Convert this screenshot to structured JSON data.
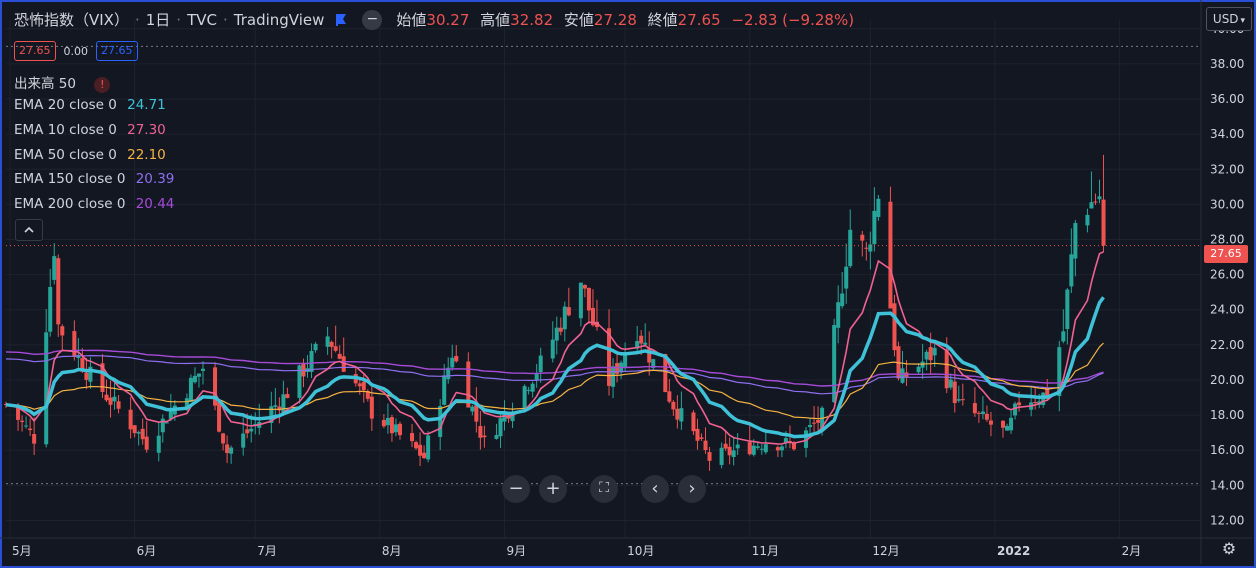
{
  "header": {
    "symbol_title": "恐怖指数（VIX）",
    "interval": "1日",
    "exchange": "TVC",
    "source": "TradingView",
    "flag_icon": "flag-icon",
    "hide_icon": "minus-circle-icon",
    "ohlc": [
      {
        "label": "始値",
        "value": "30.27"
      },
      {
        "label": "高値",
        "value": "32.82"
      },
      {
        "label": "安値",
        "value": "27.28"
      },
      {
        "label": "終値",
        "value": "27.65"
      }
    ],
    "change": "−2.83 (−9.28%)",
    "price_badges": {
      "bid": "27.65",
      "spread": "0.00",
      "ask": "27.65"
    },
    "currency": "USD"
  },
  "indicators": [
    {
      "label": "出来高 50",
      "value": "",
      "color": "#d1d4dc",
      "warning_icon": "exclamation-icon"
    },
    {
      "label": "EMA 20 close 0",
      "value": "24.71",
      "color": "#3fc1d8"
    },
    {
      "label": "EMA 10 close 0",
      "value": "27.30",
      "color": "#f06292"
    },
    {
      "label": "EMA 50 close 0",
      "value": "22.10",
      "color": "#f5b342"
    },
    {
      "label": "EMA 150 close 0",
      "value": "20.39",
      "color": "#8e6ff0"
    },
    {
      "label": "EMA 200 close 0",
      "value": "20.44",
      "color": "#a64bd8"
    }
  ],
  "collapse_icon": "chevron-up-icon",
  "last_price_label": "27.65",
  "navigation": {
    "zoom_out_icon": "minus-icon",
    "zoom_in_icon": "plus-icon",
    "reset_icon": "reset-view-icon",
    "scroll_left_icon": "chevron-left-icon",
    "scroll_right_icon": "chevron-right-icon",
    "settings_icon": "gear-icon"
  },
  "chart_data": {
    "type": "candlestick",
    "ylim": [
      11,
      40.5
    ],
    "y_ticks": [
      "40.00",
      "38.00",
      "36.00",
      "34.00",
      "32.00",
      "30.00",
      "28.00",
      "26.00",
      "24.00",
      "22.00",
      "20.00",
      "18.00",
      "16.00",
      "14.00",
      "12.00"
    ],
    "x_ticks": [
      "5月",
      "6月",
      "7月",
      "8月",
      "9月",
      "10月",
      "11月",
      "12月",
      "2022",
      "2月"
    ],
    "x_tick_dates": [
      "2021-05-01",
      "2021-06-01",
      "2021-07-01",
      "2021-08-01",
      "2021-09-01",
      "2021-10-01",
      "2021-11-01",
      "2021-12-01",
      "2022-01-01",
      "2022-02-01"
    ],
    "x_range": [
      "2021-04-30",
      "2022-02-21"
    ],
    "dotted_high_level": 39.0,
    "dotted_low_level": 14.1,
    "series_colors": {
      "up": "#26a69a",
      "down": "#ef5350"
    },
    "ohlc_anchor": [
      {
        "date": "2021-04-30",
        "close": 18.6
      },
      {
        "date": "2021-05-07",
        "close": 16.7
      },
      {
        "date": "2021-05-12",
        "close": 27.6
      },
      {
        "date": "2021-05-13",
        "close": 23.1
      },
      {
        "date": "2021-05-21",
        "close": 20.2
      },
      {
        "date": "2021-06-04",
        "close": 16.4
      },
      {
        "date": "2021-06-18",
        "close": 20.7
      },
      {
        "date": "2021-06-24",
        "close": 15.9
      },
      {
        "date": "2021-07-08",
        "close": 19.0
      },
      {
        "date": "2021-07-19",
        "close": 22.5
      },
      {
        "date": "2021-07-30",
        "close": 18.2
      },
      {
        "date": "2021-08-12",
        "close": 15.6
      },
      {
        "date": "2021-08-19",
        "close": 21.6
      },
      {
        "date": "2021-08-27",
        "close": 16.4
      },
      {
        "date": "2021-09-10",
        "close": 20.9
      },
      {
        "date": "2021-09-20",
        "close": 25.7
      },
      {
        "date": "2021-09-27",
        "close": 19.9
      },
      {
        "date": "2021-10-04",
        "close": 22.9
      },
      {
        "date": "2021-10-13",
        "close": 18.6
      },
      {
        "date": "2021-10-22",
        "close": 15.5
      },
      {
        "date": "2021-11-05",
        "close": 16.5
      },
      {
        "date": "2021-11-12",
        "close": 16.3
      },
      {
        "date": "2021-11-19",
        "close": 17.9
      },
      {
        "date": "2021-11-26",
        "close": 28.6
      },
      {
        "date": "2021-11-30",
        "close": 27.2
      },
      {
        "date": "2021-12-03",
        "close": 30.7
      },
      {
        "date": "2021-12-08",
        "close": 19.9
      },
      {
        "date": "2021-12-17",
        "close": 21.6
      },
      {
        "date": "2021-12-23",
        "close": 18.6
      },
      {
        "date": "2022-01-04",
        "close": 16.9
      },
      {
        "date": "2022-01-07",
        "close": 18.8
      },
      {
        "date": "2022-01-14",
        "close": 19.2
      },
      {
        "date": "2022-01-18",
        "close": 22.8
      },
      {
        "date": "2022-01-21",
        "close": 28.9
      },
      {
        "date": "2022-01-24",
        "close": 29.9
      },
      {
        "date": "2022-01-27",
        "close": 30.5
      },
      {
        "date": "2022-01-28",
        "close": 27.65
      }
    ],
    "ema_end_values": {
      "ema10": 27.3,
      "ema20": 24.71,
      "ema50": 22.1,
      "ema150": 20.39,
      "ema200": 20.44
    }
  }
}
